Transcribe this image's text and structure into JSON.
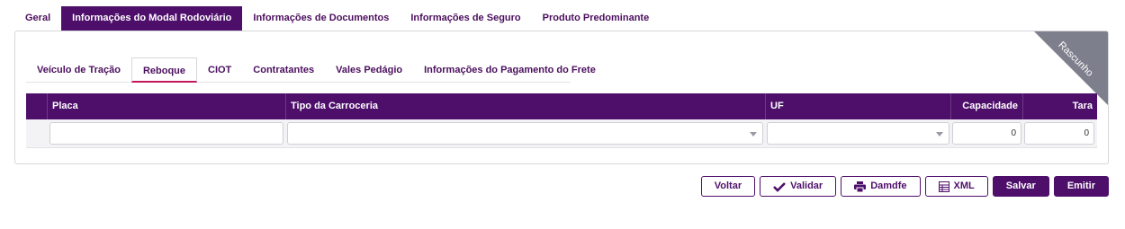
{
  "top_tabs": [
    {
      "label": "Geral"
    },
    {
      "label": "Informações do Modal Rodoviário"
    },
    {
      "label": "Informações de Documentos"
    },
    {
      "label": "Informações de Seguro"
    },
    {
      "label": "Produto Predominante"
    }
  ],
  "ribbon": {
    "label": "Rascunho"
  },
  "inner_tabs": [
    {
      "label": "Veículo de Tração"
    },
    {
      "label": "Reboque"
    },
    {
      "label": "CIOT"
    },
    {
      "label": "Contratantes"
    },
    {
      "label": "Vales Pedágio"
    },
    {
      "label": "Informações do Pagamento do Frete"
    }
  ],
  "grid": {
    "columns": [
      "Placa",
      "Tipo da Carroceria",
      "UF",
      "Capacidade",
      "Tara"
    ],
    "row": {
      "placa": "",
      "tipo_carroceria": "",
      "uf": "",
      "capacidade": "0",
      "tara": "0"
    }
  },
  "actions": {
    "voltar": "Voltar",
    "validar": "Validar",
    "damdfe": "Damdfe",
    "xml": "XML",
    "salvar": "Salvar",
    "emitir": "Emitir"
  },
  "colors": {
    "brand": "#4e0f6b",
    "accent": "#c2185b",
    "ribbon": "#7e7f8c"
  },
  "icons": {
    "validar": "check-icon",
    "damdfe": "printer-icon",
    "xml": "table-icon"
  }
}
